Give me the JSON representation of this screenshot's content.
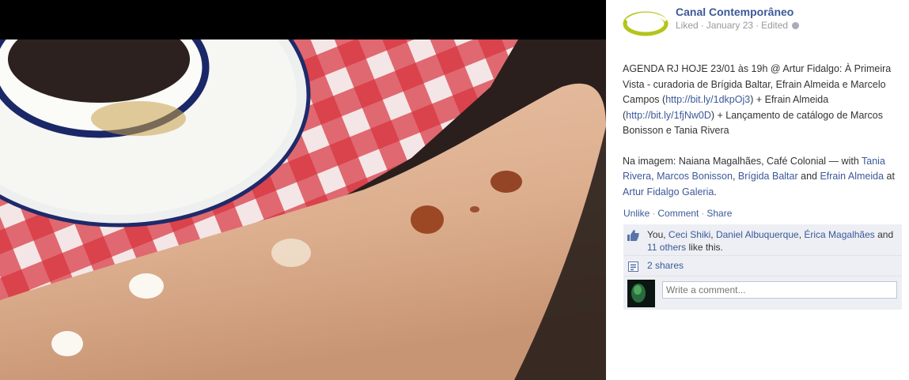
{
  "post": {
    "page_name": "Canal Contemporâneo",
    "meta": {
      "liked": "Liked",
      "date": "January 23",
      "edited": "Edited"
    },
    "text": {
      "l1_pre": "AGENDA RJ HOJE 23/01 às 19h @ Artur Fidalgo: À Primeira Vista - curadoria de Brígida Baltar, Efrain Almeida e Marcelo Campos (",
      "link1": "http://bit.ly/1dkpOj3",
      "l1_mid": ") + Efrain Almeida (",
      "link2": "http://bit.ly/1fjNw0D",
      "l1_post": ") + Lançamento de catálogo de Marcos Bonisson e Tania Rivera",
      "l2_pre": "Na imagem: Naiana Magalhães, Café Colonial",
      "l2_with": " — with ",
      "tag1": "Tania Rivera",
      "tag2": "Marcos Bonisson",
      "tag3": "Brígida Baltar",
      "l2_and": " and ",
      "tag4": "Efrain Almeida",
      "l2_at": " at ",
      "place": "Artur Fidalgo Galeria",
      "period": "."
    }
  },
  "actions": {
    "unlike": "Unlike",
    "comment": "Comment",
    "share": "Share"
  },
  "likes": {
    "you": "You, ",
    "p1": "Ceci Shiki",
    "p2": "Daniel Albuquerque",
    "p3": "Érica Magalhães",
    "and": " and ",
    "others": "11 others",
    "suffix": " like this."
  },
  "shares": "2 shares",
  "comment": {
    "placeholder": "Write a comment..."
  },
  "icons": {
    "logo": "page-logo-icon",
    "globe": "globe-icon",
    "like": "thumbs-up-icon",
    "share": "share-icon"
  },
  "colors": {
    "link": "#3b5998",
    "logo_green": "#b5c41a"
  }
}
